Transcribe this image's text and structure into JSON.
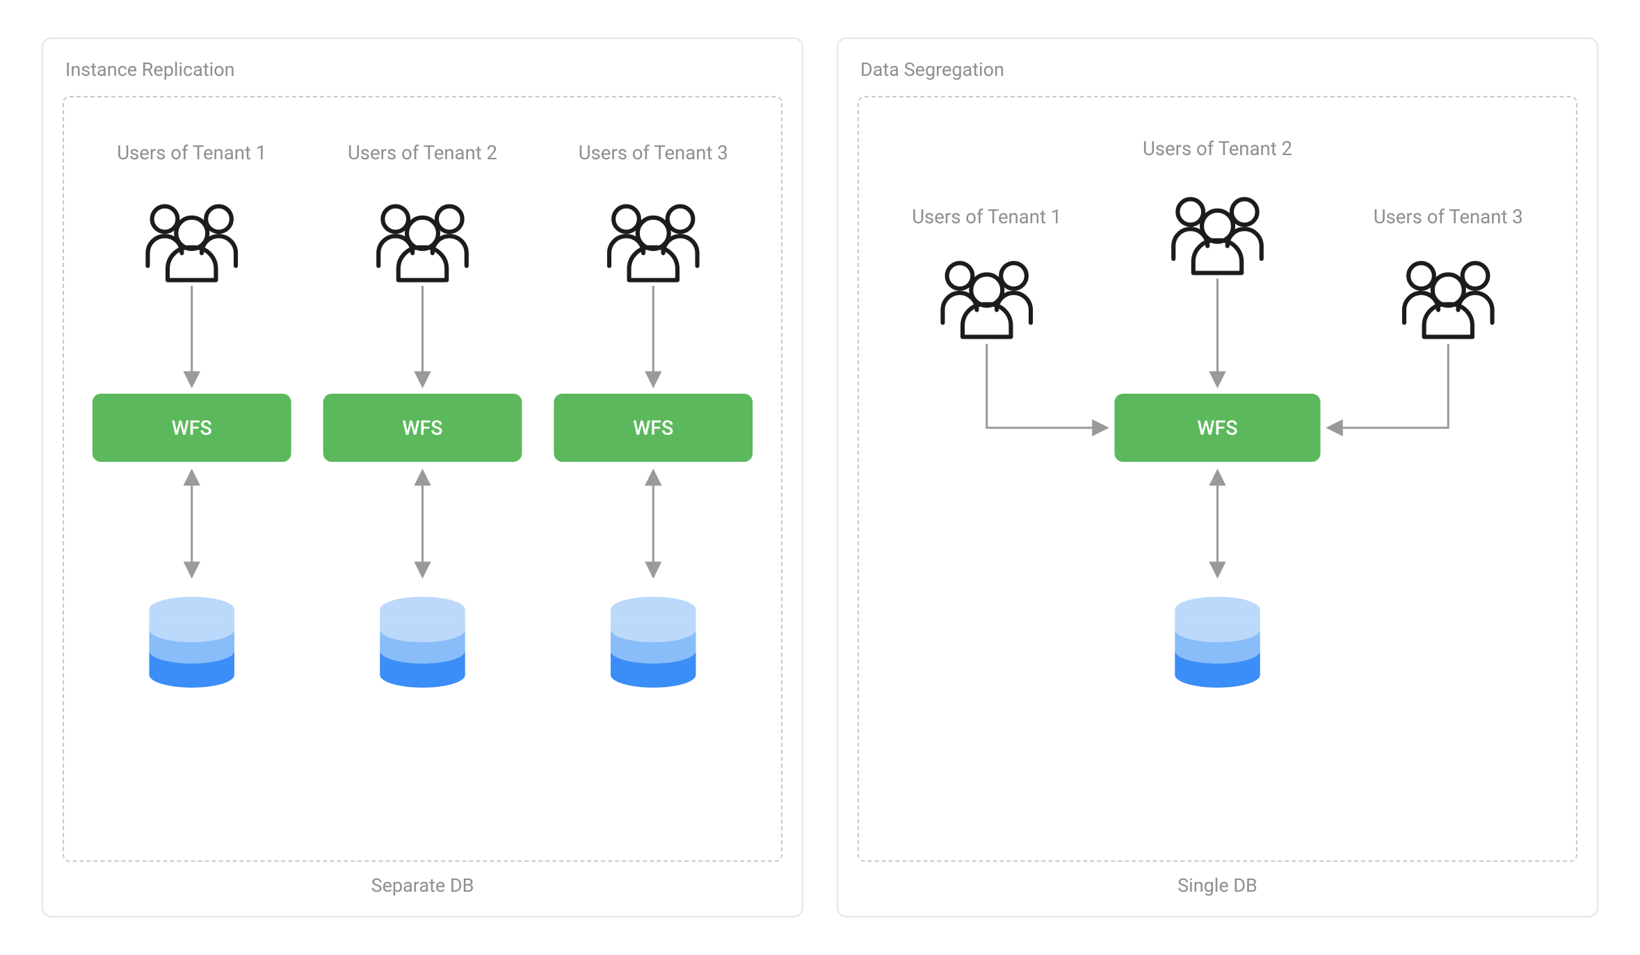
{
  "left": {
    "title": "Instance Replication",
    "subtitle": "Separate DB",
    "tenants": [
      {
        "label": "Users of Tenant 1",
        "box": "WFS"
      },
      {
        "label": "Users of Tenant 2",
        "box": "WFS"
      },
      {
        "label": "Users of Tenant 3",
        "box": "WFS"
      }
    ]
  },
  "right": {
    "title": "Data Segregation",
    "subtitle": "Single DB",
    "tenants": [
      {
        "label": "Users of Tenant 1"
      },
      {
        "label": "Users of Tenant 2"
      },
      {
        "label": "Users of Tenant 3"
      }
    ],
    "box": "WFS"
  },
  "colors": {
    "green": "#5cb85c",
    "dbTop": "#bcd9fb",
    "dbMid": "#89bdf9",
    "dbBot": "#3b8df7"
  }
}
